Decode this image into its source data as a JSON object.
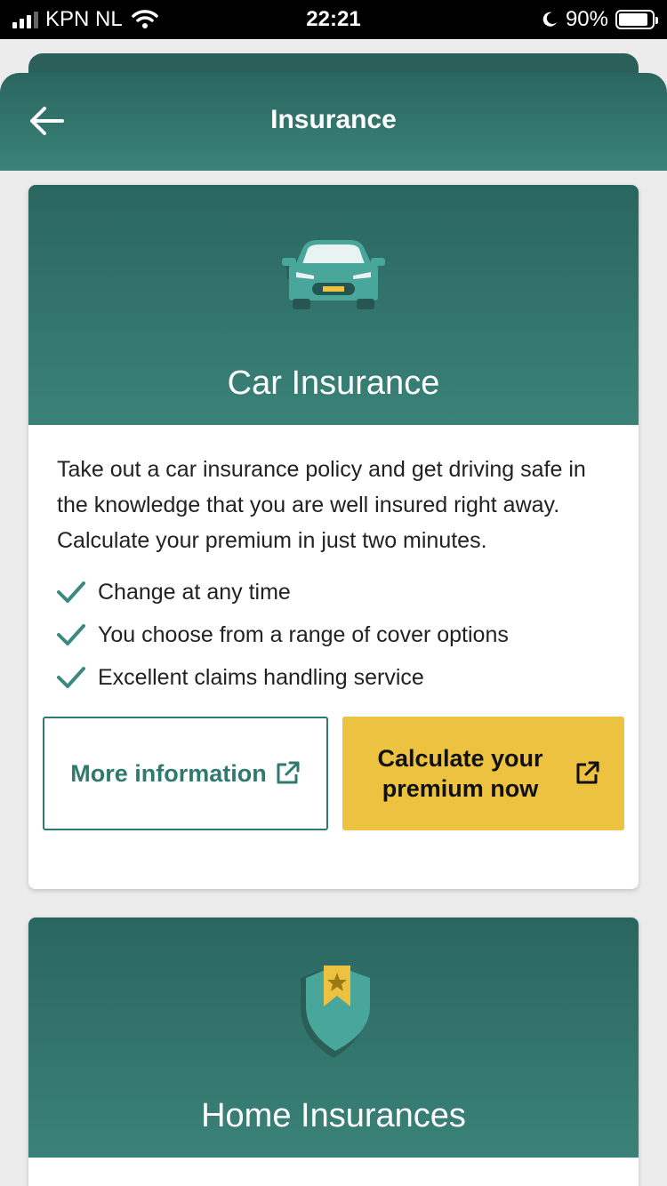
{
  "status_bar": {
    "carrier": "KPN NL",
    "time": "22:21",
    "battery": "90%",
    "battery_level": 0.9
  },
  "header": {
    "title": "Insurance",
    "back_icon": "arrow-left-icon"
  },
  "cards": [
    {
      "title": "Car Insurance",
      "icon": "car-icon",
      "description": "Take out a car insurance policy and get driving safe in the knowledge that you are well insured right away. Calculate your premium in just two minutes.",
      "features": [
        "Change at any time",
        "You choose from a range of cover options",
        "Excellent claims handling service"
      ],
      "more_info_label": "More information",
      "calculate_label": "Calculate your premium now"
    },
    {
      "title": "Home Insurances",
      "icon": "shield-star-icon"
    }
  ],
  "colors": {
    "brand_green": "#2f7a70",
    "accent_yellow": "#ecc240"
  }
}
